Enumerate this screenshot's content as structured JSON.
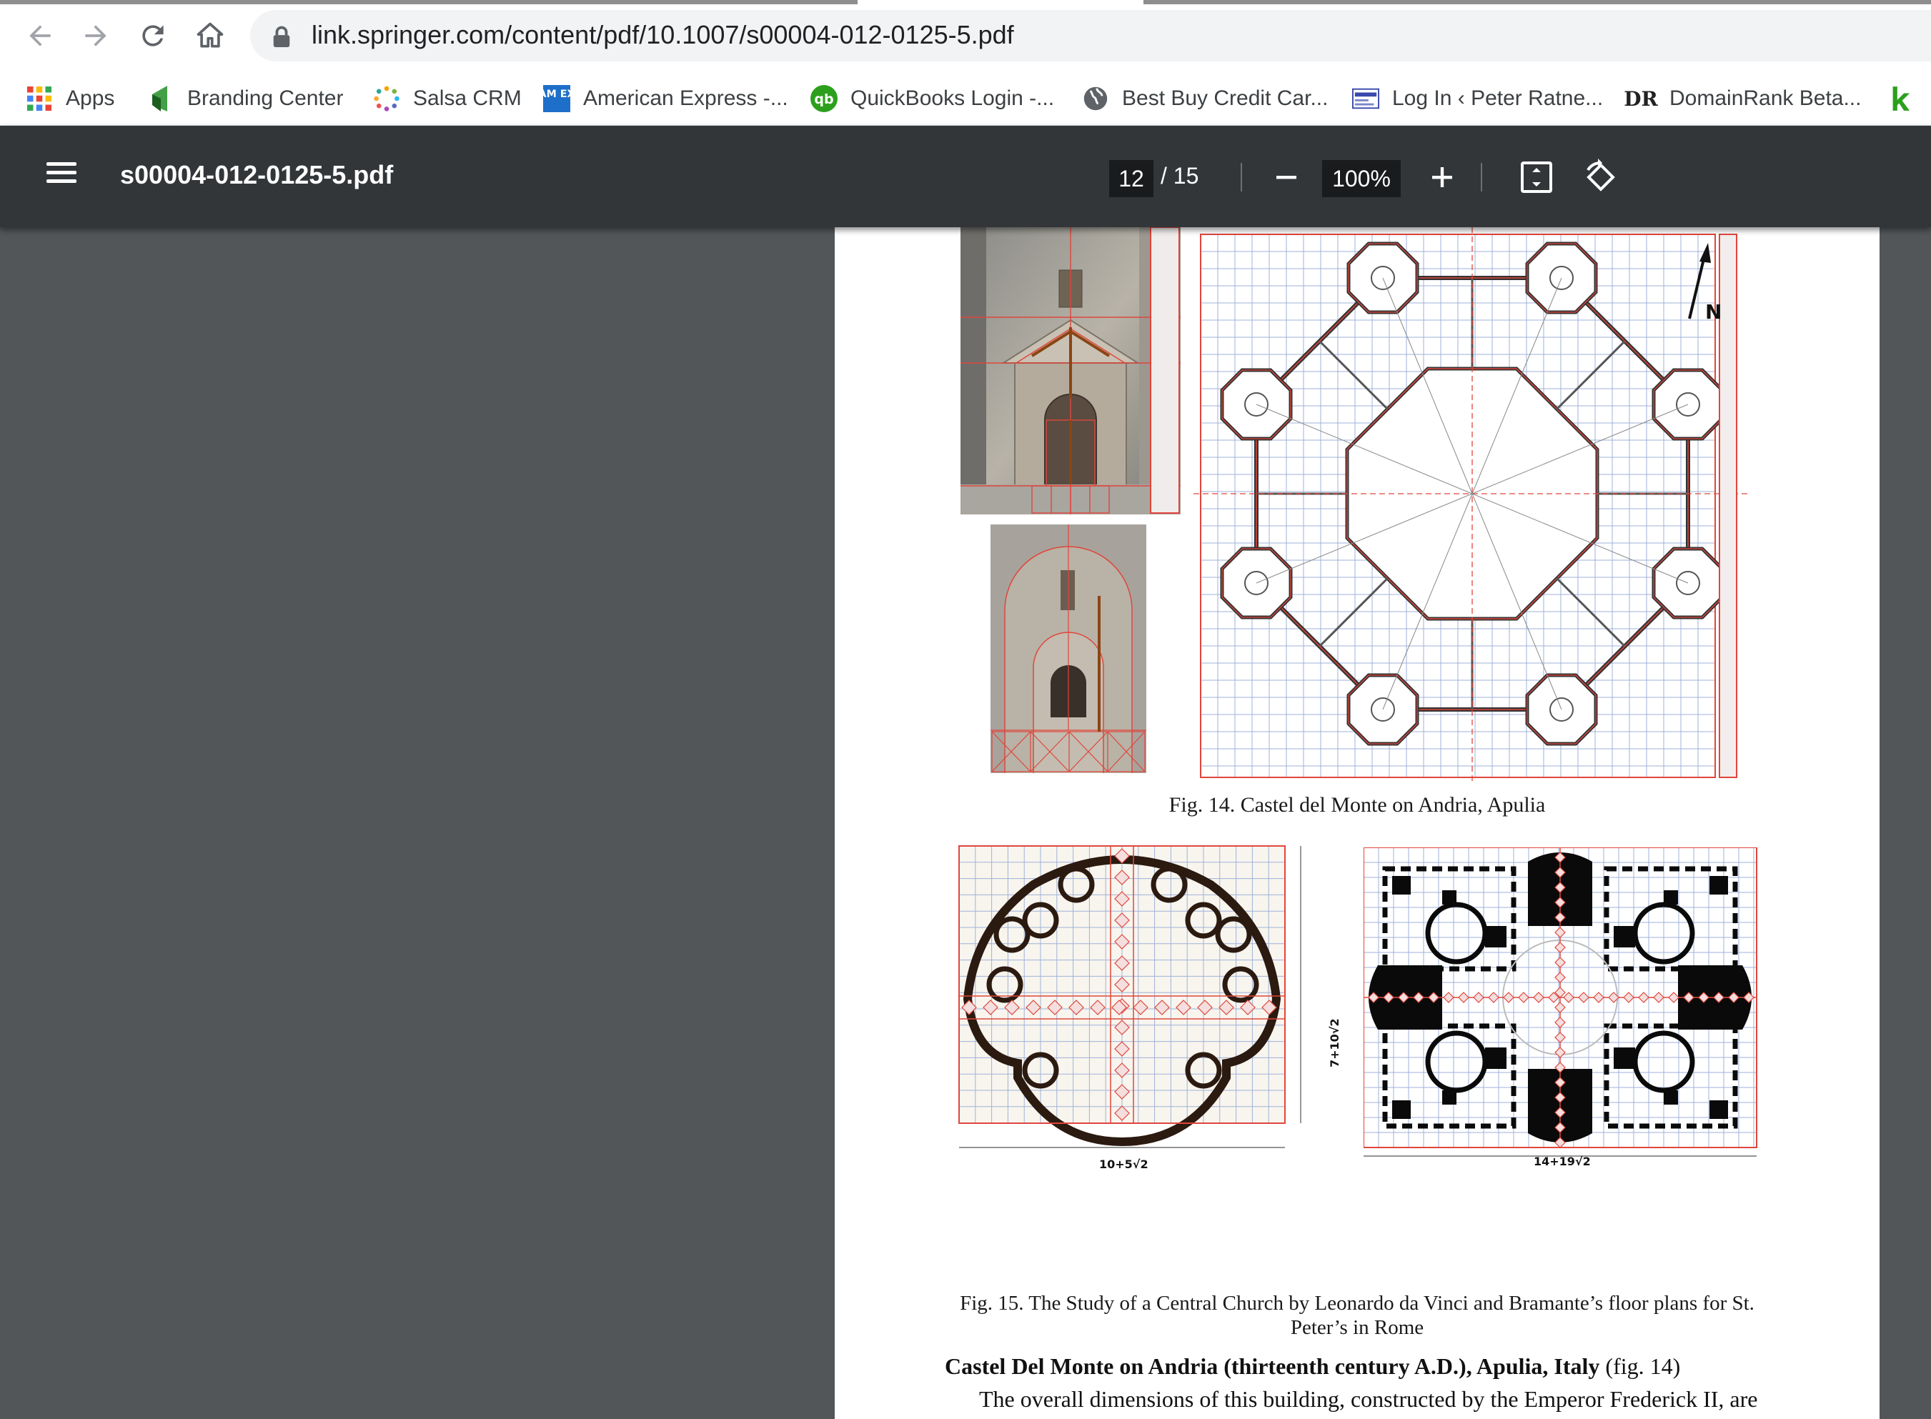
{
  "browser": {
    "url": "link.springer.com/content/pdf/10.1007/s00004-012-0125-5.pdf",
    "bookmarks": [
      {
        "label": "Apps",
        "icon": "apps-grid-icon"
      },
      {
        "label": "Branding Center",
        "icon": "branding-center-icon"
      },
      {
        "label": "Salsa CRM",
        "icon": "salsa-crm-icon"
      },
      {
        "label": "American Express -...",
        "icon": "amex-icon"
      },
      {
        "label": "QuickBooks Login -...",
        "icon": "quickbooks-icon"
      },
      {
        "label": "Best Buy Credit Car...",
        "icon": "globe-icon"
      },
      {
        "label": "Log In ‹ Peter Ratne...",
        "icon": "login-site-icon"
      },
      {
        "label": "DomainRank Beta...",
        "icon": "domainrank-icon"
      }
    ],
    "bookmark_icon_text": {
      "amex": "AM EX",
      "quickbooks": "qb",
      "domainrank": "DR"
    }
  },
  "viewer": {
    "title": "s00004-012-0125-5.pdf",
    "current_page": "12",
    "total_pages": "/ 15",
    "zoom": "100%"
  },
  "document": {
    "fig14": {
      "caption": "Fig. 14. Castel del Monte on Andria, Apulia",
      "north_label": "N"
    },
    "fig15": {
      "caption_line1": "Fig. 15. The Study of a Central Church by Leonardo da Vinci and Bramante’s floor plans for St.",
      "caption_line2": "Peter’s in Rome",
      "left_width_label": "10+5√2",
      "left_height_label": "7+10√2",
      "right_width_label": "14+19√2"
    },
    "section_heading": "Castel Del Monte on Andria (thirteenth century A.D.), Apulia, Italy",
    "section_heading_ref": " (fig. 14)",
    "body_text": "The overall dimensions of this building, constructed by the Emperor Frederick II, are"
  },
  "colors": {
    "viewer_toolbar": "#323639",
    "viewer_background": "#525659",
    "grid_red": "#e0463c",
    "grid_blue": "#9fb2d8"
  }
}
